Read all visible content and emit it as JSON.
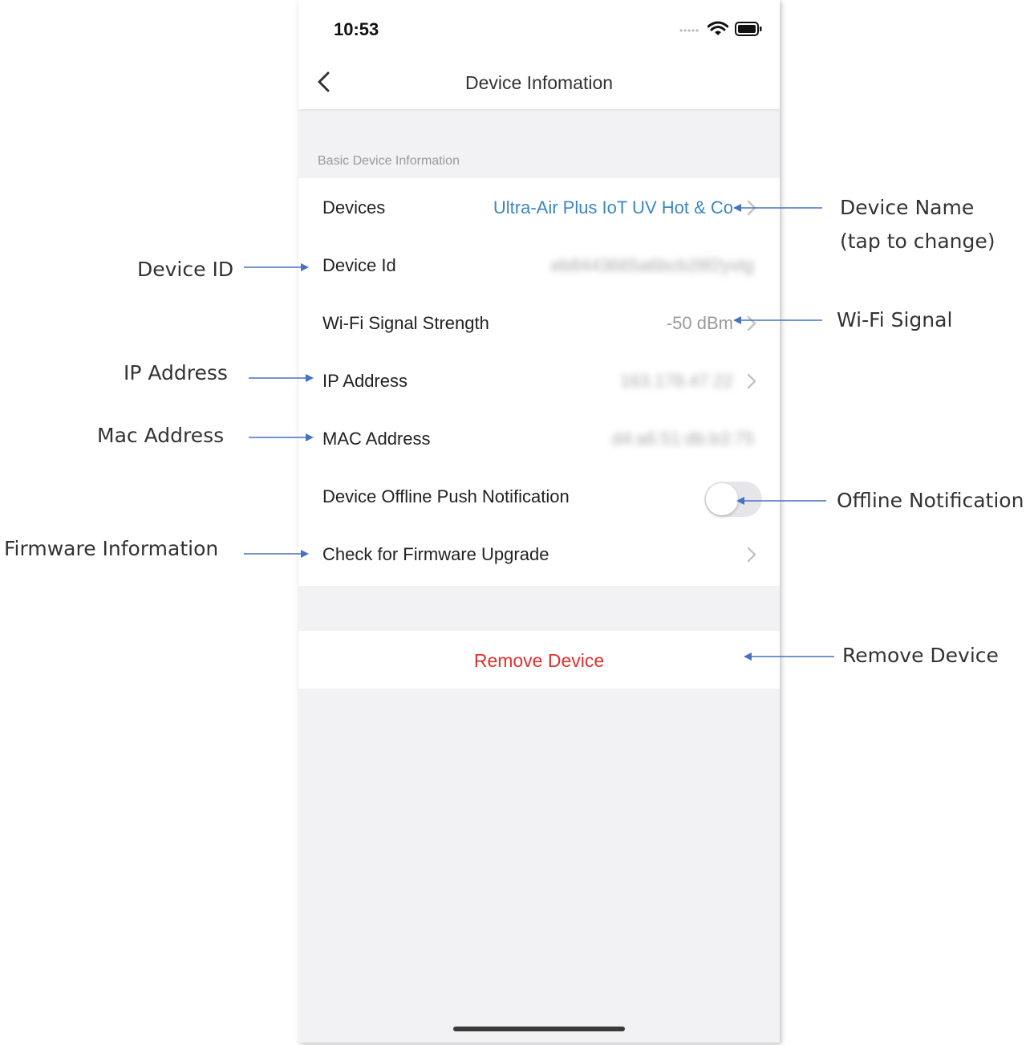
{
  "status_bar": {
    "time": "10:53"
  },
  "nav": {
    "title": "Device Infomation"
  },
  "section": {
    "header": "Basic Device Information"
  },
  "rows": [
    {
      "label": "Devices",
      "value": "Ultra-Air Plus IoT UV Hot & Co"
    },
    {
      "label": "Device Id",
      "value": "eb8443665a6bcb28f2yvtg"
    },
    {
      "label": "Wi-Fi Signal Strength",
      "value": "-50 dBm"
    },
    {
      "label": "IP Address",
      "value": "163.178.47.22"
    },
    {
      "label": "MAC Address",
      "value": "d4:a6:51:db:b3:75"
    },
    {
      "label": "Device Offline Push Notification",
      "toggle_on": false
    },
    {
      "label": "Check for Firmware Upgrade"
    }
  ],
  "remove": {
    "label": "Remove Device"
  },
  "callouts": {
    "device_name_line1": "Device Name",
    "device_name_line2": "(tap to change)",
    "device_id": "Device ID",
    "wifi_signal": "Wi-Fi Signal",
    "ip_address": "IP Address",
    "mac_address": "Mac Address",
    "offline_notification": "Offline Notification",
    "firmware_information": "Firmware Information",
    "remove_device": "Remove Device"
  },
  "colors": {
    "accent_blue": "#3b86c4",
    "destructive_red": "#e0302c",
    "arrow_blue": "#4472c4"
  }
}
